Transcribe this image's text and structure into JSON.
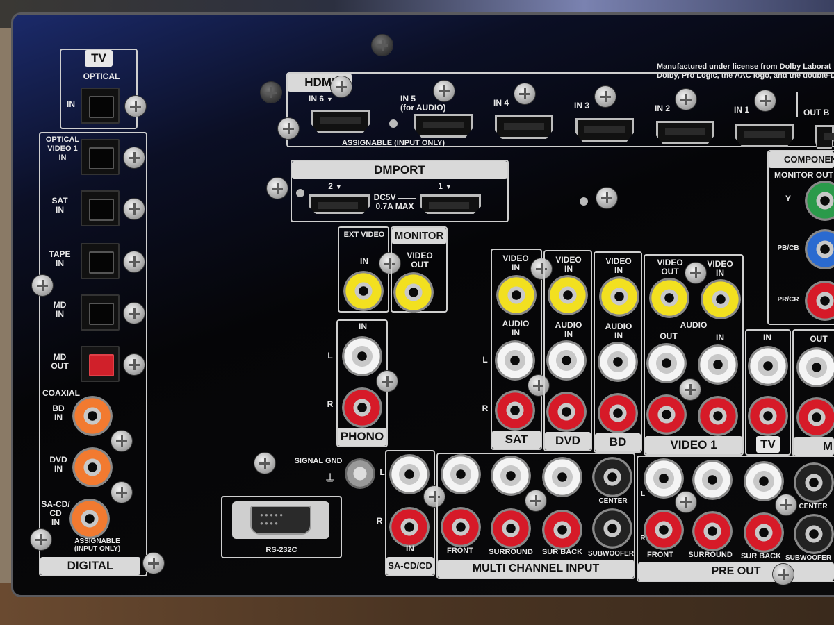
{
  "tv_group": {
    "title": "TV",
    "optical": "OPTICAL",
    "in": "IN"
  },
  "optical_inputs": [
    {
      "label": "OPTICAL\nVIDEO 1\nIN"
    },
    {
      "label": "SAT\nIN"
    },
    {
      "label": "TAPE\nIN"
    },
    {
      "label": "MD\nIN"
    },
    {
      "label": "MD\nOUT"
    }
  ],
  "coaxial": {
    "title": "COAXIAL",
    "items": [
      "BD\nIN",
      "DVD\nIN",
      "SA-CD/\nCD\nIN"
    ],
    "note": "ASSIGNABLE\n(INPUT ONLY)"
  },
  "digital_label": "DIGITAL",
  "hdmi": {
    "title": "HDMI",
    "ports": [
      "IN 6",
      "IN 5\n(for AUDIO)",
      "IN 4",
      "IN 3",
      "IN 2",
      "IN 1",
      "OUT B"
    ],
    "note": "ASSIGNABLE (INPUT ONLY)"
  },
  "dmport": {
    "title": "DMPORT",
    "port2": "2",
    "port1": "1",
    "power": "DC5V ═══\n0.7A MAX"
  },
  "ext_video": {
    "title": "EXT VIDEO",
    "in": "IN"
  },
  "monitor": {
    "title": "MONITOR",
    "video_out": "VIDEO\nOUT"
  },
  "phono": {
    "title": "PHONO",
    "in": "IN",
    "l": "L",
    "r": "R"
  },
  "sat": {
    "title": "SAT",
    "video_in": "VIDEO\nIN",
    "audio_in": "AUDIO\nIN",
    "l": "L",
    "r": "R"
  },
  "dvd": {
    "title": "DVD",
    "video_in": "VIDEO\nIN",
    "audio_in": "AUDIO\nIN"
  },
  "bd": {
    "title": "BD",
    "video_in": "VIDEO\nIN",
    "audio_in": "AUDIO\nIN"
  },
  "video1": {
    "title": "VIDEO 1",
    "video_out": "VIDEO\nOUT",
    "video_in": "VIDEO\nIN",
    "audio": "AUDIO",
    "out": "OUT",
    "in": "IN"
  },
  "tv_audio": {
    "title": "TV",
    "in": "IN"
  },
  "out_group": {
    "out": "OUT",
    "title": "M"
  },
  "component": {
    "title": "COMPONENT",
    "monitor_out": "MONITOR OUT",
    "y": "Y",
    "pb": "PB/CB",
    "pr": "PR/CR"
  },
  "signal_gnd": "SIGNAL GND",
  "gnd_symbol": "⏚",
  "rs232c": "RS-232C",
  "sacd": {
    "title": "SA-CD/CD",
    "in": "IN",
    "r": "R"
  },
  "multi_channel": {
    "title": "MULTI CHANNEL INPUT",
    "labels": [
      "FRONT",
      "SURROUND",
      "SUR BACK",
      "SUBWOOFER"
    ],
    "center": "CENTER"
  },
  "pre_out": {
    "title": "PRE OUT",
    "labels": [
      "FRONT",
      "SURROUND",
      "SUR BACK",
      "SUBWOOFER"
    ],
    "center": "CENTER",
    "l": "L",
    "r": "R"
  },
  "legal": "Manufactured under license from Dolby Laborat\nDolby, Pro Logic, the AAC logo, and the double-D"
}
